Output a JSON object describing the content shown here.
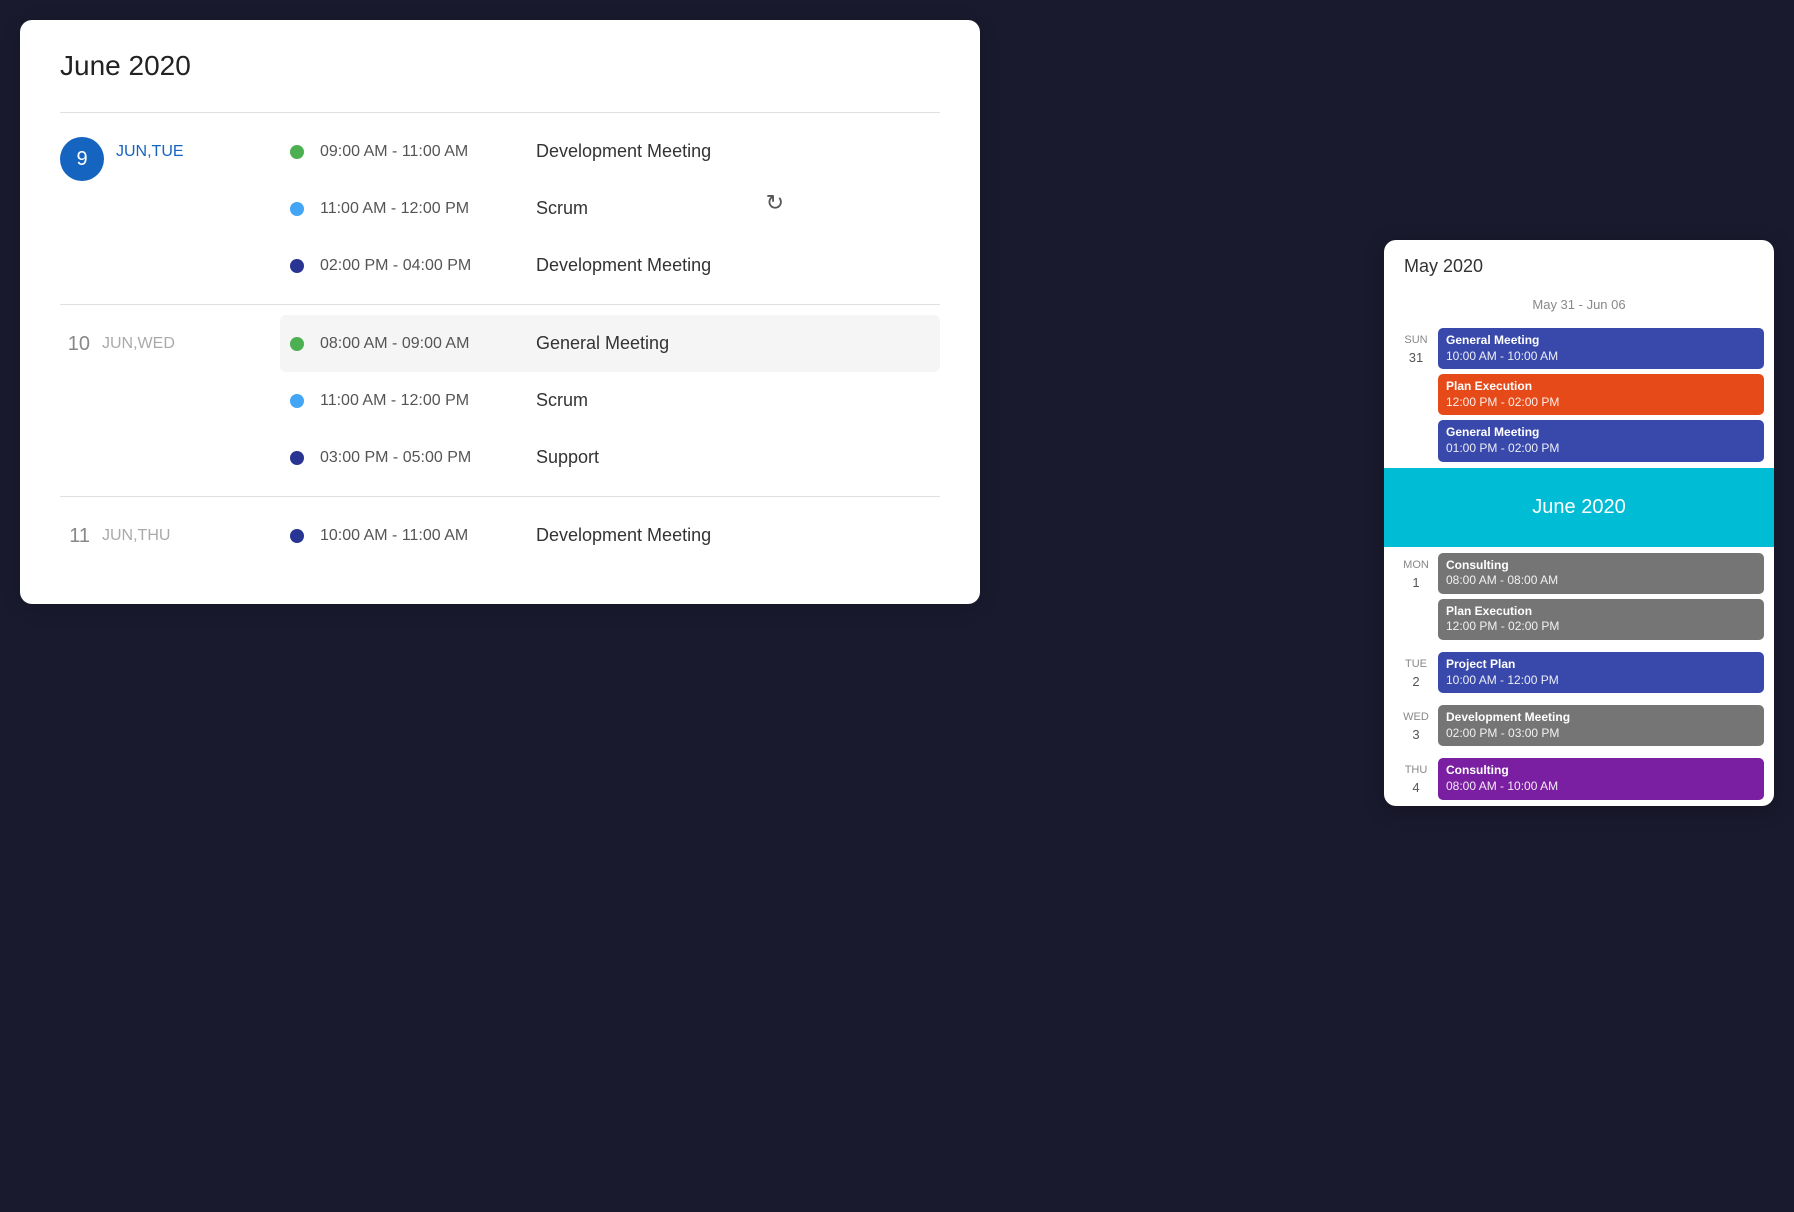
{
  "main": {
    "title": "June 2020",
    "days": [
      {
        "number": "9",
        "dayLabel": "JUN,TUE",
        "isActive": true,
        "events": [
          {
            "dotColor": "green",
            "time": "09:00 AM - 11:00 AM",
            "name": "Development Meeting",
            "highlighted": false
          },
          {
            "dotColor": "blue",
            "time": "11:00 AM - 12:00 PM",
            "name": "Scrum",
            "highlighted": false
          },
          {
            "dotColor": "darkblue",
            "time": "02:00 PM - 04:00 PM",
            "name": "Development Meeting",
            "highlighted": false
          }
        ]
      },
      {
        "number": "10",
        "dayLabel": "JUN,WED",
        "isActive": false,
        "events": [
          {
            "dotColor": "green",
            "time": "08:00 AM - 09:00 AM",
            "name": "General Meeting",
            "highlighted": true
          },
          {
            "dotColor": "blue",
            "time": "11:00 AM - 12:00 PM",
            "name": "Scrum",
            "highlighted": false
          },
          {
            "dotColor": "darkblue",
            "time": "03:00 PM - 05:00 PM",
            "name": "Support",
            "highlighted": false
          }
        ]
      },
      {
        "number": "11",
        "dayLabel": "JUN,THU",
        "isActive": false,
        "events": [
          {
            "dotColor": "darkblue",
            "time": "10:00 AM - 11:00 AM",
            "name": "Development Meeting",
            "highlighted": false
          }
        ]
      }
    ]
  },
  "refresh_icon": "↻",
  "mini": {
    "title": "May 2020",
    "week_range": "May 31 - Jun 06",
    "sun31_events": [
      {
        "title": "General Meeting",
        "time": "10:00 AM - 10:00 AM",
        "color": "blue"
      },
      {
        "title": "Plan Execution",
        "time": "12:00 PM - 02:00 PM",
        "color": "orange"
      },
      {
        "title": "General Meeting",
        "time": "01:00 PM - 02:00 PM",
        "color": "blue"
      }
    ],
    "sun_label": "SUN",
    "sun_number": "31",
    "june_banner": "June 2020",
    "mon_label": "MON",
    "mon_number": "1",
    "mon_events": [
      {
        "title": "Consulting",
        "time": "08:00 AM - 08:00 AM",
        "color": "gray"
      },
      {
        "title": "Plan Execution",
        "time": "12:00 PM - 02:00 PM",
        "color": "gray"
      }
    ],
    "tue_label": "TUE",
    "tue_number": "2",
    "tue_events": [
      {
        "title": "Project Plan",
        "time": "10:00 AM - 12:00 PM",
        "color": "indigo"
      }
    ],
    "wed_label": "WED",
    "wed_number": "3",
    "wed_events": [
      {
        "title": "Development Meeting",
        "time": "02:00 PM - 03:00 PM",
        "color": "gray"
      }
    ],
    "thu_label": "THU",
    "thu_number": "4",
    "thu_events": [
      {
        "title": "Consulting",
        "time": "08:00 AM - 10:00 AM",
        "color": "purple"
      }
    ]
  }
}
